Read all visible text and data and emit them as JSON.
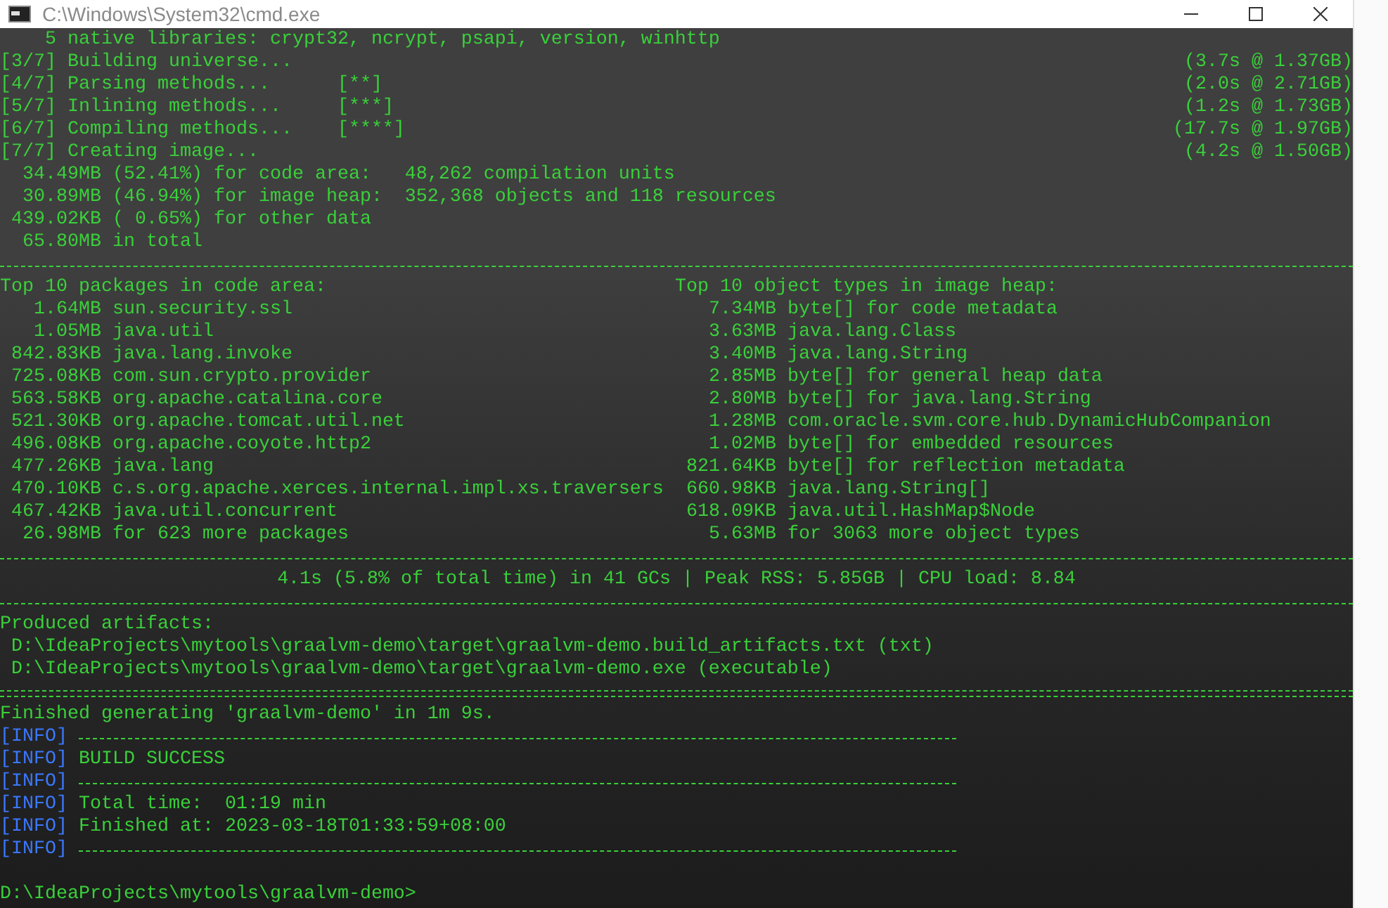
{
  "window": {
    "title": "C:\\Windows\\System32\\cmd.exe"
  },
  "lines": [
    {
      "kind": "text",
      "text": "    5 native libraries: crypt32, ncrypt, psapi, version, winhttp"
    },
    {
      "kind": "text",
      "text": "[3/7] Building universe...",
      "right": "(3.7s @ 1.37GB)"
    },
    {
      "kind": "text",
      "text": "[4/7] Parsing methods...      [**]",
      "right": "(2.0s @ 2.71GB)"
    },
    {
      "kind": "text",
      "text": "[5/7] Inlining methods...     [***]",
      "right": "(1.2s @ 1.73GB)"
    },
    {
      "kind": "text",
      "text": "[6/7] Compiling methods...    [****]",
      "right": "(17.7s @ 1.97GB)"
    },
    {
      "kind": "text",
      "text": "[7/7] Creating image...",
      "right": "(4.2s @ 1.50GB)"
    },
    {
      "kind": "text",
      "text": "  34.49MB (52.41%) for code area:   48,262 compilation units"
    },
    {
      "kind": "text",
      "text": "  30.89MB (46.94%) for image heap:  352,368 objects and 118 resources"
    },
    {
      "kind": "text",
      "text": " 439.02KB ( 0.65%) for other data"
    },
    {
      "kind": "text",
      "text": "  65.80MB in total"
    },
    {
      "kind": "rule"
    },
    {
      "kind": "columns",
      "text": "Top 10 packages in code area:",
      "column_2": "Top 10 object types in image heap:"
    },
    {
      "kind": "columns",
      "text": "   1.64MB sun.security.ssl",
      "column_2": "   7.34MB byte[] for code metadata"
    },
    {
      "kind": "columns",
      "text": "   1.05MB java.util",
      "column_2": "   3.63MB java.lang.Class"
    },
    {
      "kind": "columns",
      "text": " 842.83KB java.lang.invoke",
      "column_2": "   3.40MB java.lang.String"
    },
    {
      "kind": "columns",
      "text": " 725.08KB com.sun.crypto.provider",
      "column_2": "   2.85MB byte[] for general heap data"
    },
    {
      "kind": "columns",
      "text": " 563.58KB org.apache.catalina.core",
      "column_2": "   2.80MB byte[] for java.lang.String"
    },
    {
      "kind": "columns",
      "text": " 521.30KB org.apache.tomcat.util.net",
      "column_2": "   1.28MB com.oracle.svm.core.hub.DynamicHubCompanion"
    },
    {
      "kind": "columns",
      "text": " 496.08KB org.apache.coyote.http2",
      "column_2": "   1.02MB byte[] for embedded resources"
    },
    {
      "kind": "columns",
      "text": " 477.26KB java.lang",
      "column_2": " 821.64KB byte[] for reflection metadata"
    },
    {
      "kind": "columns",
      "text": " 470.10KB c.s.org.apache.xerces.internal.impl.xs.traversers",
      "column_2": " 660.98KB java.lang.String[]"
    },
    {
      "kind": "columns",
      "text": " 467.42KB java.util.concurrent",
      "column_2": " 618.09KB java.util.HashMap$Node"
    },
    {
      "kind": "columns",
      "text": "  26.98MB for 623 more packages",
      "column_2": "   5.63MB for 3063 more object types"
    },
    {
      "kind": "rule"
    },
    {
      "kind": "center",
      "text": "4.1s (5.8% of total time) in 41 GCs | Peak RSS: 5.85GB | CPU load: 8.84"
    },
    {
      "kind": "rule"
    },
    {
      "kind": "text",
      "text": "Produced artifacts:"
    },
    {
      "kind": "text",
      "text": " D:\\IdeaProjects\\mytools\\graalvm-demo\\target\\graalvm-demo.build_artifacts.txt (txt)"
    },
    {
      "kind": "text",
      "text": " D:\\IdeaProjects\\mytools\\graalvm-demo\\target\\graalvm-demo.exe (executable)"
    },
    {
      "kind": "double-rule"
    },
    {
      "kind": "text",
      "text": "Finished generating 'graalvm-demo' in 1m 9s."
    },
    {
      "kind": "info-rule",
      "tag": "[INFO]"
    },
    {
      "kind": "info",
      "tag": "[INFO]",
      "text": "BUILD SUCCESS"
    },
    {
      "kind": "info-rule",
      "tag": "[INFO]"
    },
    {
      "kind": "info",
      "tag": "[INFO]",
      "text": "Total time:  01:19 min"
    },
    {
      "kind": "info",
      "tag": "[INFO]",
      "text": "Finished at: 2023-03-18T01:33:59+08:00"
    },
    {
      "kind": "info-rule",
      "tag": "[INFO]"
    },
    {
      "kind": "blank"
    },
    {
      "kind": "text",
      "text": "D:\\IdeaProjects\\mytools\\graalvm-demo>"
    }
  ]
}
